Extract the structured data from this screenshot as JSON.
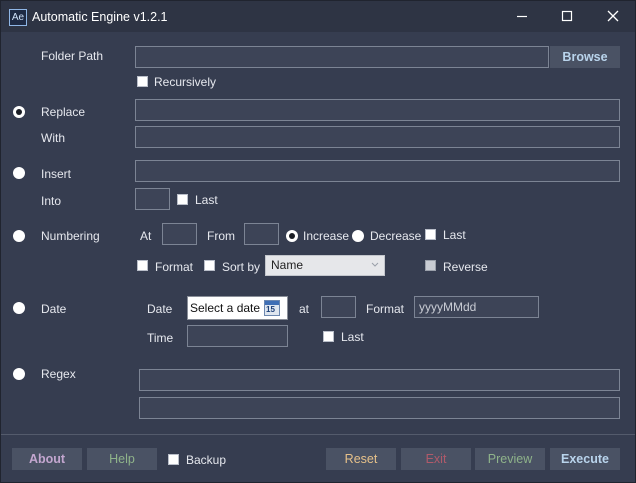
{
  "window": {
    "app_icon_text": "Ae",
    "title": "Automatic Engine v1.2.1"
  },
  "folder": {
    "label": "Folder Path",
    "value": "",
    "browse_label": "Browse",
    "recursive_label": "Recursively",
    "recursive_checked": false
  },
  "replace": {
    "label": "Replace",
    "with_label": "With",
    "replace_value": "",
    "with_value": "",
    "selected": true
  },
  "insert": {
    "label": "Insert",
    "into_label": "Into",
    "insert_value": "",
    "into_value": "",
    "last_label": "Last",
    "last_checked": false
  },
  "numbering": {
    "label": "Numbering",
    "at_label": "At",
    "from_label": "From",
    "at_value": "",
    "from_value": "",
    "increase_label": "Increase",
    "decrease_label": "Decrease",
    "increase_selected": true,
    "last_label": "Last",
    "format_label": "Format",
    "sortby_label": "Sort by",
    "sort_selected": "Name",
    "reverse_label": "Reverse"
  },
  "date": {
    "label": "Date",
    "date_label": "Date",
    "date_placeholder": "Select a date",
    "calendar_day": "15",
    "at_label": "at",
    "at_value": "",
    "format_label": "Format",
    "format_value": "yyyyMMdd",
    "time_label": "Time",
    "time_value": "",
    "last_label": "Last"
  },
  "regex": {
    "label": "Regex",
    "pattern_value": "",
    "replacement_value": ""
  },
  "footer": {
    "about_label": "About",
    "help_label": "Help",
    "backup_label": "Backup",
    "reset_label": "Reset",
    "exit_label": "Exit",
    "preview_label": "Preview",
    "execute_label": "Execute"
  },
  "colors": {
    "background": "#363d50",
    "about": "#c3a6cf",
    "help": "#8fb38a",
    "reset": "#e6c18a",
    "exit": "#b05a6a",
    "preview": "#8fb38a",
    "execute": "#b9d4ec",
    "browse": "#b9d4ec"
  }
}
